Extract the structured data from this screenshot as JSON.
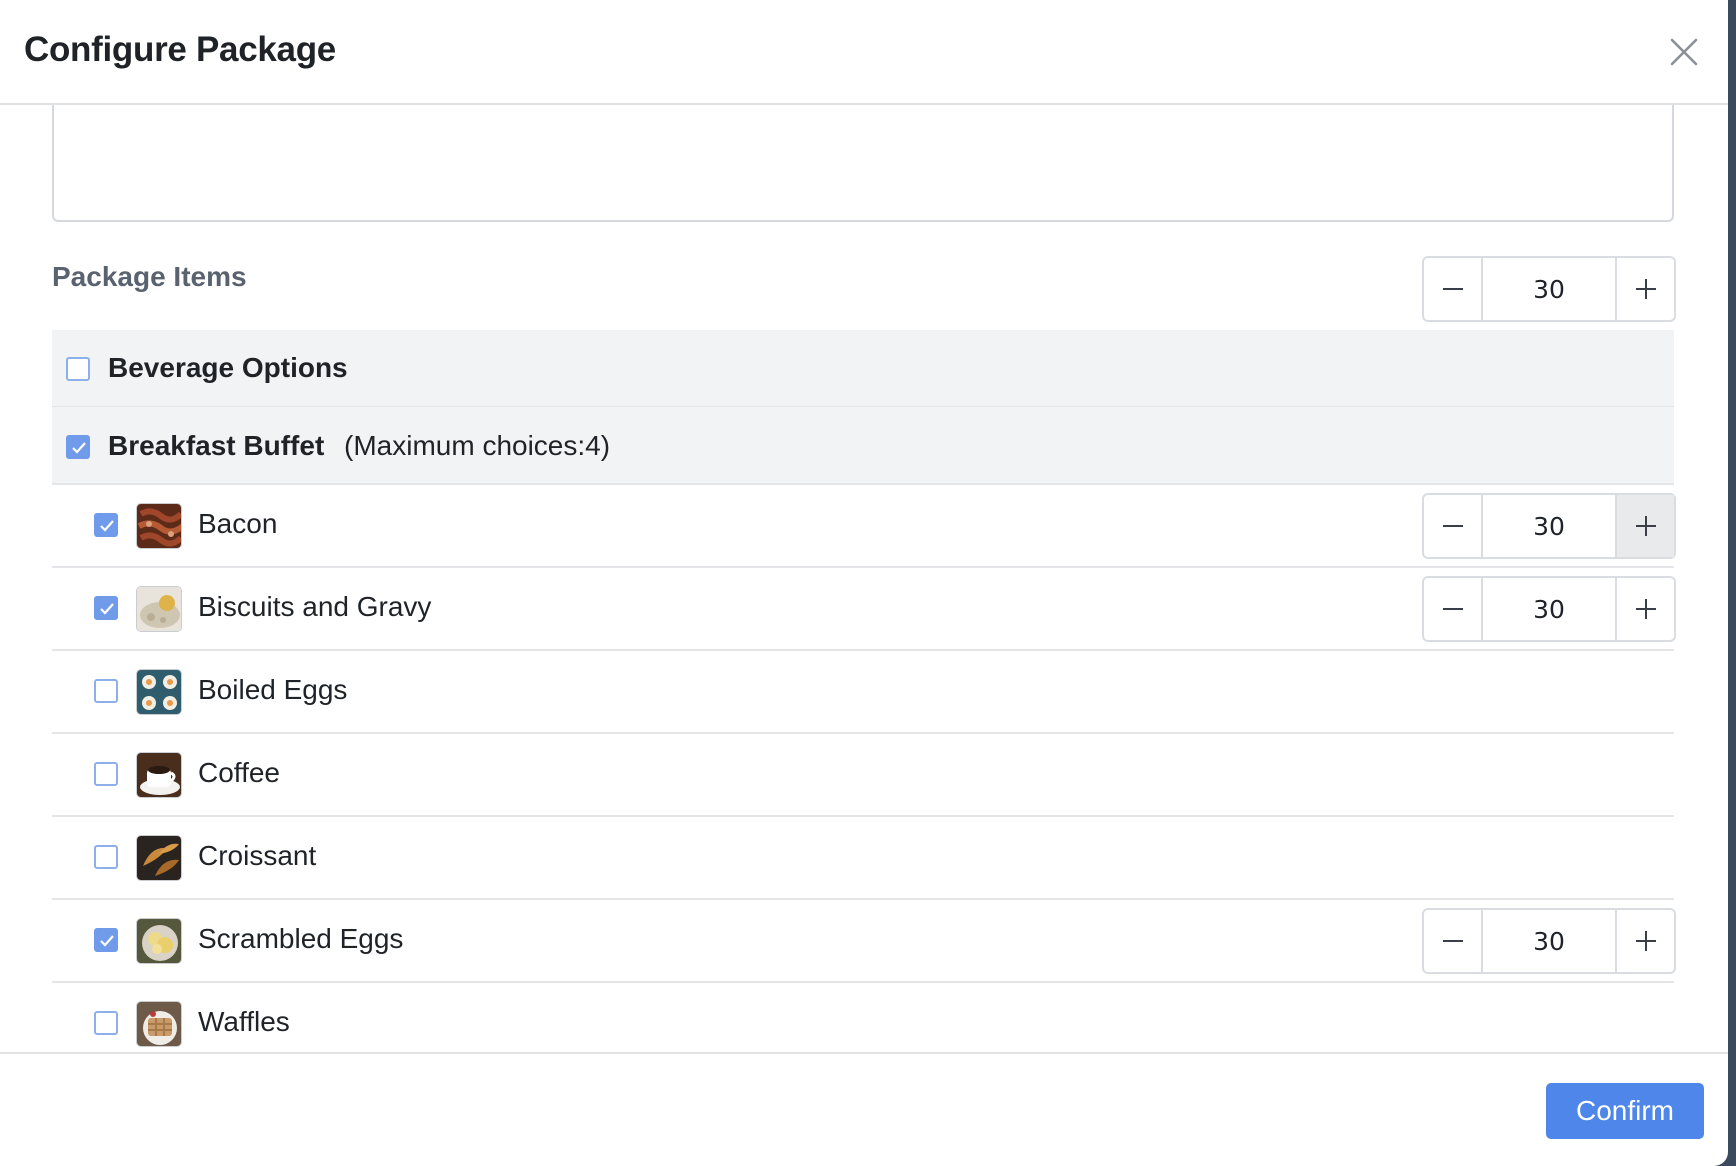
{
  "modal": {
    "title": "Configure Package",
    "close_icon": "close-icon"
  },
  "package": {
    "section_label": "Package Items",
    "quantity": "30"
  },
  "groups": [
    {
      "title": "Beverage Options",
      "note": "",
      "checked": false
    },
    {
      "title": "Breakfast Buffet",
      "note": "(Maximum choices:4)",
      "checked": true
    }
  ],
  "items": [
    {
      "label": "Bacon",
      "checked": true,
      "quantity": "30",
      "thumb_colors": [
        "#5c2a18",
        "#a0462a",
        "#d9a27a"
      ]
    },
    {
      "label": "Biscuits and Gravy",
      "checked": true,
      "quantity": "30",
      "thumb_colors": [
        "#e8e4db",
        "#cfc6b2",
        "#e0b24a"
      ]
    },
    {
      "label": "Boiled Eggs",
      "checked": false,
      "quantity": "",
      "thumb_colors": [
        "#2f5d6e",
        "#f1eee4",
        "#e89b4a"
      ]
    },
    {
      "label": "Coffee",
      "checked": false,
      "quantity": "",
      "thumb_colors": [
        "#4a2e1d",
        "#ffffff",
        "#2a1a10"
      ]
    },
    {
      "label": "Croissant",
      "checked": false,
      "quantity": "",
      "thumb_colors": [
        "#2a2420",
        "#c98a3d",
        "#a86a28"
      ]
    },
    {
      "label": "Scrambled Eggs",
      "checked": true,
      "quantity": "30",
      "thumb_colors": [
        "#55583d",
        "#efd98a",
        "#e9cf6b"
      ]
    },
    {
      "label": "Waffles",
      "checked": false,
      "quantity": "",
      "thumb_colors": [
        "#6d5a48",
        "#c99a6a",
        "#f0ede6"
      ]
    }
  ],
  "footer": {
    "confirm_label": "Confirm"
  },
  "colors": {
    "accent": "#4f86ea",
    "checkbox_checked": "#6f9bea",
    "group_bg": "#f2f3f5"
  }
}
